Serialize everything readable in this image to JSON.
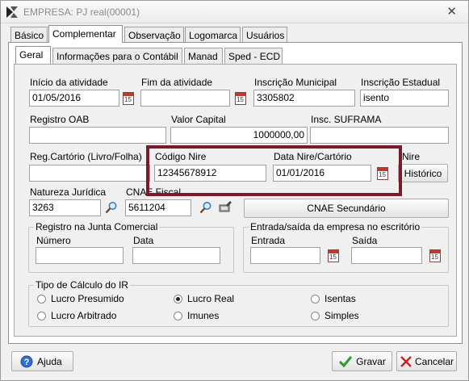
{
  "window": {
    "title": "EMPRESA: PJ real(00001)",
    "close_label": "✕"
  },
  "tabs_top": [
    {
      "label": "Básico"
    },
    {
      "label": "Complementar"
    },
    {
      "label": "Observação"
    },
    {
      "label": "Logomarca"
    },
    {
      "label": "Usuários"
    }
  ],
  "tabs_sub": [
    {
      "label": "Geral"
    },
    {
      "label": "Informações para o Contábil"
    },
    {
      "label": "Manad"
    },
    {
      "label": "Sped - ECD"
    }
  ],
  "fields": {
    "inicio_atividade": {
      "label": "Início da atividade",
      "value": "01/05/2016"
    },
    "fim_atividade": {
      "label": "Fim da atividade",
      "value": ""
    },
    "inscricao_municipal": {
      "label": "Inscrição Municipal",
      "value": "3305802"
    },
    "inscricao_estadual": {
      "label": "Inscrição Estadual",
      "value": "isento"
    },
    "registro_oab": {
      "label": "Registro OAB",
      "value": ""
    },
    "valor_capital": {
      "label": "Valor Capital",
      "value": "1000000,00"
    },
    "insc_suframa": {
      "label": "Insc. SUFRAMA",
      "value": ""
    },
    "reg_cartorio": {
      "label": "Reg.Cartório (Livro/Folha)",
      "value": ""
    },
    "codigo_nire": {
      "label": "Código Nire",
      "value": "12345678912"
    },
    "data_nire": {
      "label": "Data Nire/Cartório",
      "value": "01/01/2016"
    },
    "nire_partial_label": "Nire",
    "natureza_juridica": {
      "label": "Natureza Jurídica",
      "value": "3263"
    },
    "cnae_fiscal": {
      "label": "CNAE Fiscal",
      "value": "5611204"
    }
  },
  "buttons": {
    "historico": "Histórico",
    "cnae_secundario": "CNAE Secundário",
    "ajuda": "Ajuda",
    "gravar": "Gravar",
    "cancelar": "Cancelar"
  },
  "calendar_glyph": "15",
  "group_junta": {
    "title": "Registro na Junta Comercial",
    "numero_label": "Número",
    "numero_value": "",
    "data_label": "Data",
    "data_value": ""
  },
  "group_entrada": {
    "title": "Entrada/saída da empresa no escritório",
    "entrada_label": "Entrada",
    "entrada_value": "",
    "saida_label": "Saída",
    "saida_value": ""
  },
  "group_ir": {
    "title": "Tipo de Cálculo do IR",
    "options": [
      {
        "label": "Lucro Presumido",
        "checked": false
      },
      {
        "label": "Lucro Real",
        "checked": true
      },
      {
        "label": "Isentas",
        "checked": false
      },
      {
        "label": "Lucro Arbitrado",
        "checked": false
      },
      {
        "label": "Imunes",
        "checked": false
      },
      {
        "label": "Simples",
        "checked": false
      }
    ]
  },
  "colors": {
    "highlight_border": "#7a1a2a",
    "gravar_check": "#2a9d2a",
    "cancel_x": "#d02020",
    "help": "#2f6fd0"
  }
}
